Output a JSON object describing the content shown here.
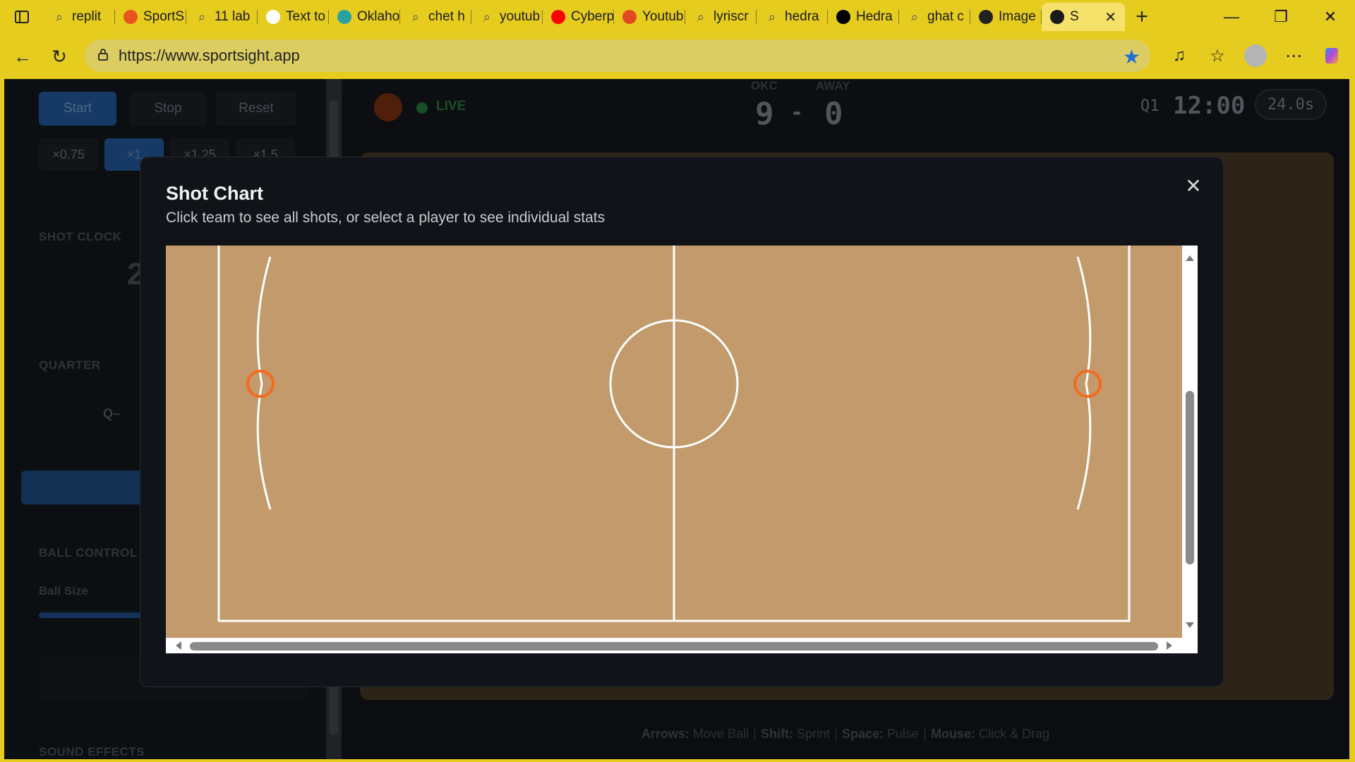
{
  "browser": {
    "tabs": [
      {
        "label": "replit",
        "icon": "search-icon",
        "color": "#555555"
      },
      {
        "label": "SportS",
        "icon": "sportsight-icon",
        "color": "#e8541d"
      },
      {
        "label": "11 lab",
        "icon": "search-icon",
        "color": "#555555"
      },
      {
        "label": "Text to",
        "icon": "elevenlabs-icon",
        "color": "#ffffff"
      },
      {
        "label": "Oklaho",
        "icon": "bing-icon",
        "color": "#2aa1a1"
      },
      {
        "label": "chet h",
        "icon": "search-icon",
        "color": "#555555"
      },
      {
        "label": "youtub",
        "icon": "search-icon",
        "color": "#555555"
      },
      {
        "label": "Cyberp",
        "icon": "youtube-icon",
        "color": "#ff0000"
      },
      {
        "label": "Youtub",
        "icon": "sync-icon",
        "color": "#e34a1f"
      },
      {
        "label": "lyriscr",
        "icon": "search-icon",
        "color": "#555555"
      },
      {
        "label": "hedra",
        "icon": "search-icon",
        "color": "#555555"
      },
      {
        "label": "Hedra",
        "icon": "hedra-icon",
        "color": "#000000"
      },
      {
        "label": "ghat c",
        "icon": "search-icon",
        "color": "#555555"
      },
      {
        "label": "Image",
        "icon": "openai-icon",
        "color": "#222222"
      },
      {
        "label": "S",
        "icon": "sportsight-app-icon",
        "color": "#1a1a1a"
      }
    ],
    "url": "https://www.sportsight.app"
  },
  "sidebar": {
    "start_label": "Start",
    "stop_label": "Stop",
    "reset_label": "Reset",
    "speeds": [
      "×0.75",
      "×1",
      "×1.25",
      "×1.5"
    ],
    "selected_speed": "×1",
    "shot_clock_label": "SHOT CLOCK",
    "shot_clock_value": "2",
    "quarter_label": "QUARTER",
    "quarter_value": "Q–",
    "ball_control_label": "BALL CONTROL",
    "ball_size_label": "Ball Size",
    "sound_effects_label": "SOUND EFFECTS"
  },
  "scoreboard": {
    "live_label": "LIVE",
    "home_team": "OKC",
    "away_team": "AWAY",
    "home_score": "9",
    "dash": "-",
    "away_score": "0",
    "quarter": "Q1",
    "game_clock": "12:00",
    "shot_clock": "24.0s"
  },
  "hints": {
    "arrows_key": "Arrows:",
    "arrows_desc": "Move Ball",
    "shift_key": "Shift:",
    "shift_desc": "Sprint",
    "space_key": "Space:",
    "space_desc": "Pulse",
    "mouse_key": "Mouse:",
    "mouse_desc": "Click & Drag"
  },
  "modal": {
    "title": "Shot Chart",
    "subtitle": "Click team to see all shots, or select a player to see individual stats",
    "close_icon": "close-icon"
  },
  "colors": {
    "court": "#c29a6b",
    "court_lines": "#ffffff",
    "hoop": "#f26b1d",
    "accent": "#1e4d87"
  }
}
